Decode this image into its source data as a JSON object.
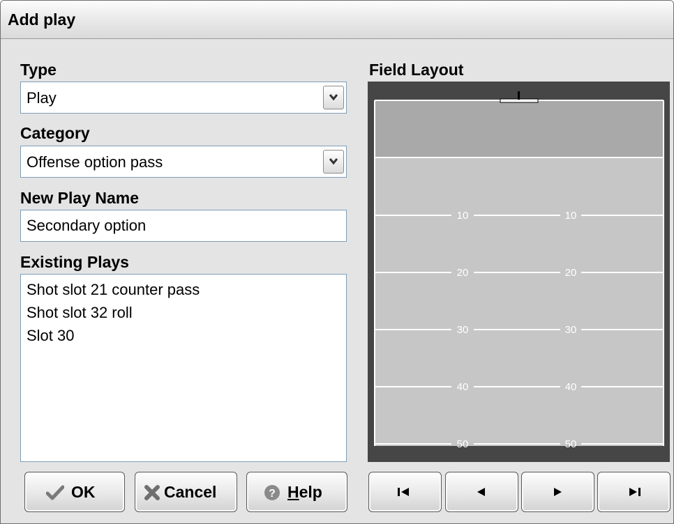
{
  "window": {
    "title": "Add play"
  },
  "type": {
    "label": "Type",
    "value": "Play"
  },
  "category": {
    "label": "Category",
    "value": "Offense option pass"
  },
  "play_name": {
    "label": "New Play Name",
    "value": "Secondary option"
  },
  "existing": {
    "label": "Existing Plays",
    "items": [
      "Shot slot 21 counter pass",
      "Shot slot 32 roll",
      "Slot 30"
    ]
  },
  "buttons": {
    "ok": {
      "label": "OK",
      "icon": "checkmark-icon"
    },
    "cancel": {
      "label": "Cancel",
      "icon": "x-icon"
    },
    "help": {
      "label_underlined": "H",
      "label_rest": "elp",
      "icon": "help-icon"
    }
  },
  "field": {
    "label": "Field Layout",
    "yard_numbers": [
      "10",
      "20",
      "30",
      "40",
      "50"
    ],
    "colors": {
      "border": "#464646",
      "endzone": "#a9a9a9",
      "turf": "#c6c6c6",
      "lines": "#ffffff"
    }
  },
  "nav": {
    "first": "first-icon",
    "prev": "previous-icon",
    "next": "next-icon",
    "last": "last-icon"
  }
}
